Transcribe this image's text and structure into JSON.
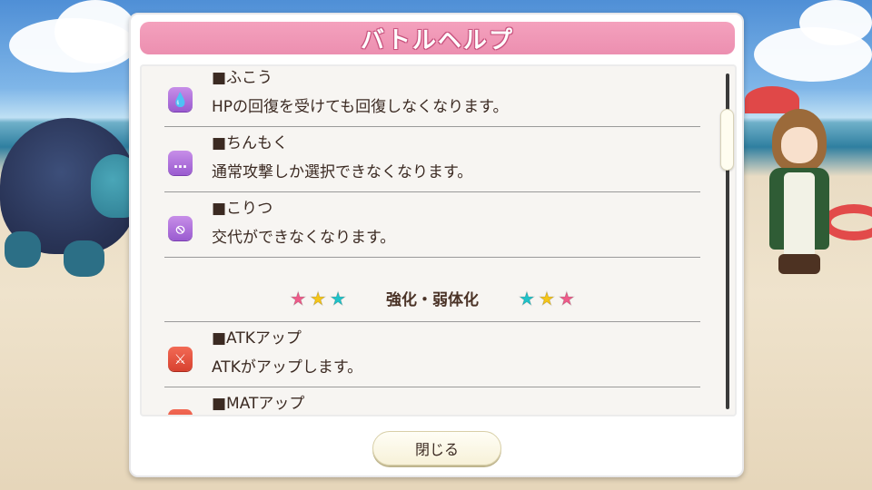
{
  "dialog": {
    "title": "バトルヘルプ",
    "close_label": "閉じる"
  },
  "entries_top": [
    {
      "icon": "sweat-drop-icon",
      "glyph": "💧",
      "name": "■ふこう",
      "desc": "HPの回復を受けても回復しなくなります。"
    },
    {
      "icon": "speech-bubble-icon",
      "glyph": "…",
      "name": "■ちんもく",
      "desc": "通常攻撃しか選択できなくなります。"
    },
    {
      "icon": "no-swap-icon",
      "glyph": "⦸",
      "name": "■こりつ",
      "desc": "交代ができなくなります。"
    }
  ],
  "section": {
    "title": "強化・弱体化",
    "stars_left": [
      "★",
      "★",
      "★"
    ],
    "stars_right": [
      "★",
      "★",
      "★"
    ]
  },
  "entries_bottom": [
    {
      "icon": "sword-icon",
      "glyph": "⚔",
      "name": "■ATKアップ",
      "desc": "ATKがアップします。"
    },
    {
      "icon": "magic-icon",
      "glyph": "✦",
      "name": "■MATアップ",
      "desc": ""
    }
  ],
  "colors": {
    "title_bar": "#ec8fb0",
    "star_pink": "#ef5b8a",
    "star_yellow": "#f5c518",
    "star_cyan": "#1fc3c9",
    "icon_purple": "#a865d8",
    "icon_red": "#e04e3b"
  }
}
